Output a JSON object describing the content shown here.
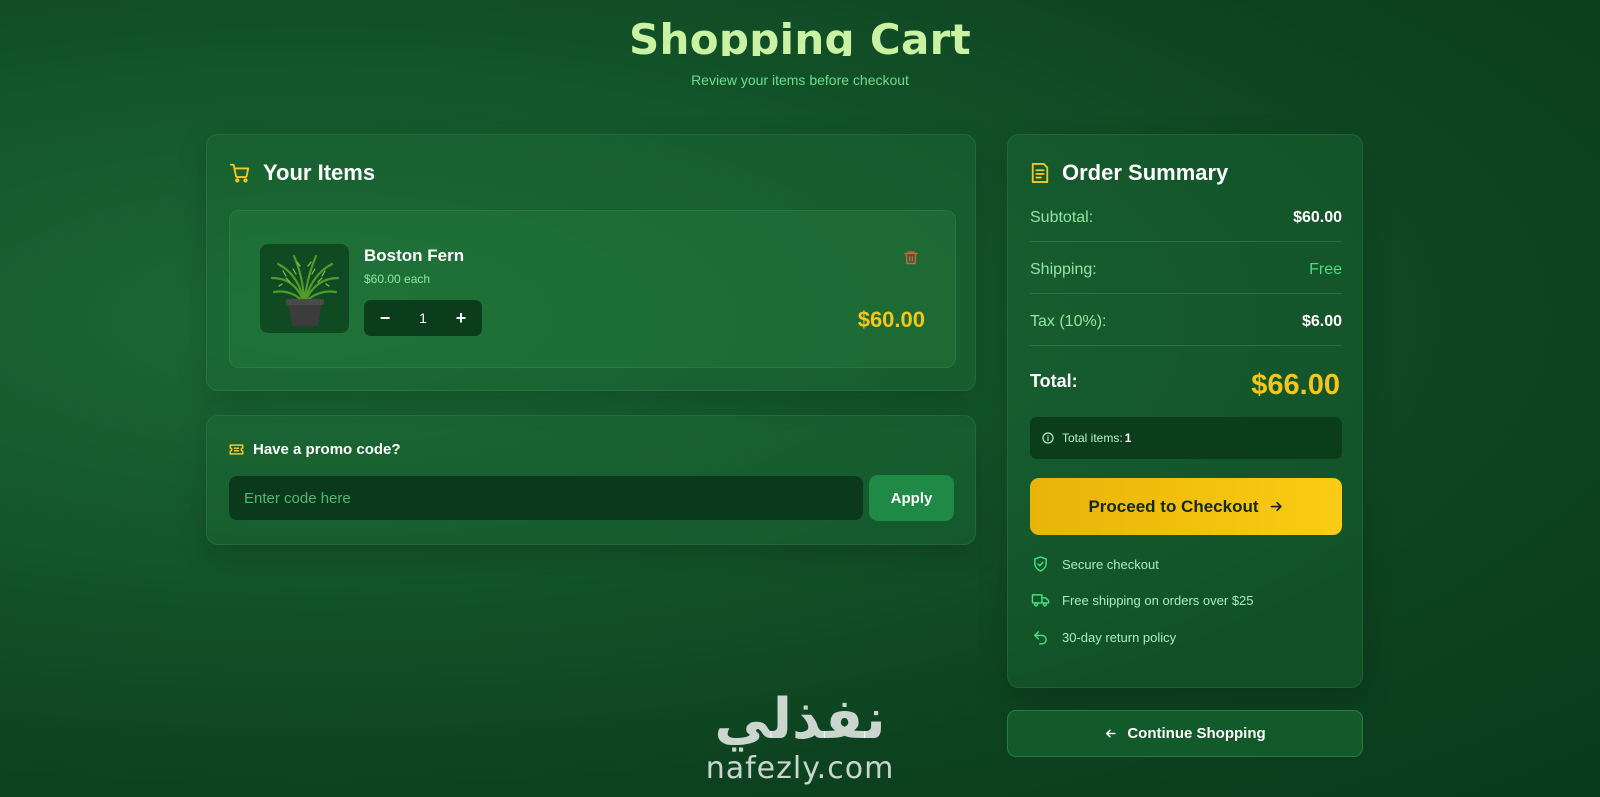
{
  "header": {
    "title": "Shopping Cart",
    "subtitle": "Review your items before checkout"
  },
  "cart": {
    "heading": "Your Items",
    "heading_icon": "cart-icon",
    "items": [
      {
        "name": "Boston Fern",
        "unit_price": "$60.00 each",
        "quantity": "1",
        "line_total": "$60.00",
        "image_icon": "plant-image"
      }
    ],
    "decrease_label": "−",
    "increase_label": "+",
    "delete_icon": "trash-icon"
  },
  "promo": {
    "heading": "Have a promo code?",
    "heading_icon": "ticket-icon",
    "placeholder": "Enter code here",
    "value": "",
    "apply_label": "Apply"
  },
  "summary": {
    "heading": "Order Summary",
    "heading_icon": "receipt-icon",
    "rows": [
      {
        "label": "Subtotal:",
        "value": "$60.00"
      },
      {
        "label": "Shipping:",
        "value": "Free"
      },
      {
        "label": "Tax (10%):",
        "value": "$6.00"
      }
    ],
    "total_label": "Total:",
    "total_value": "$66.00",
    "items_count_label": "Total items:",
    "items_count_value": "1",
    "checkout_label": "Proceed to Checkout",
    "features": [
      {
        "icon": "shield-check-icon",
        "text": "Secure checkout"
      },
      {
        "icon": "truck-icon",
        "text": "Free shipping on orders over $25"
      },
      {
        "icon": "return-icon",
        "text": "30-day return policy"
      }
    ]
  },
  "continue_label": "Continue Shopping",
  "watermark": {
    "arabic": "نفذلي",
    "latin": "nafezly.com"
  },
  "colors": {
    "accent_yellow": "#f5c518",
    "title_green": "#c9f3a2",
    "free_green": "#4ade80",
    "delete_red": "#e05a3e"
  }
}
